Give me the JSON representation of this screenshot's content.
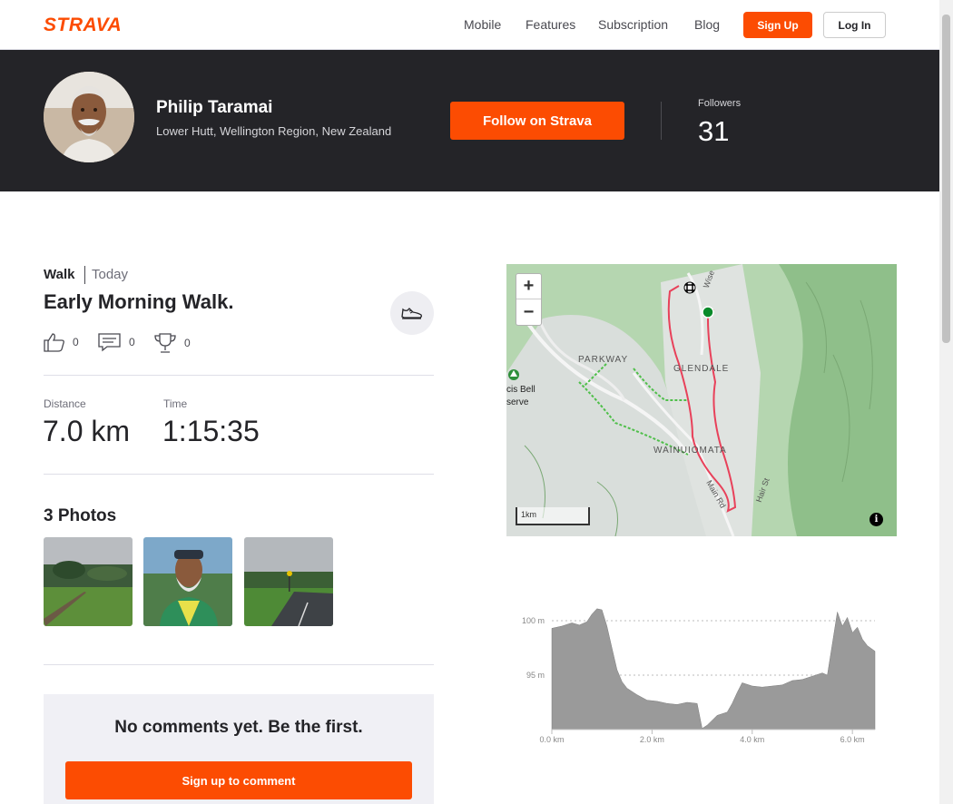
{
  "nav": {
    "logo": "STRAVA",
    "links": [
      "Mobile",
      "Features",
      "Subscription",
      "Blog"
    ],
    "signup": "Sign Up",
    "login": "Log In"
  },
  "athlete": {
    "name": "Philip Taramai",
    "location": "Lower Hutt, Wellington Region, New Zealand",
    "follow_label": "Follow on Strava",
    "followers_label": "Followers",
    "followers_count": "31"
  },
  "activity": {
    "sport": "Walk",
    "when": "Today",
    "title": "Early Morning Walk.",
    "kudos": "0",
    "comments": "0",
    "achievements": "0",
    "stats": [
      {
        "label": "Distance",
        "value": "7.0 km"
      },
      {
        "label": "Time",
        "value": "1:15:35"
      }
    ],
    "photos_title": "3 Photos"
  },
  "comments": {
    "empty_text": "No comments yet. Be the first.",
    "cta": "Sign up to comment"
  },
  "map": {
    "zoom_in": "+",
    "zoom_out": "−",
    "scale": "1km",
    "labels": [
      "PARKWAY",
      "GLENDALE",
      "WAINUIOMATA",
      "Main Rd",
      "Hair St",
      "Wise",
      "cis Bell",
      "serve"
    ],
    "info": "i"
  },
  "chart_data": {
    "type": "area",
    "title": "",
    "xlabel": "",
    "ylabel": "",
    "x_ticks": [
      "0.0 km",
      "2.0 km",
      "4.0 km",
      "6.0 km"
    ],
    "y_ticks": [
      "95 m",
      "100 m"
    ],
    "xlim": [
      0,
      6.5
    ],
    "ylim": [
      90,
      102
    ],
    "x": [
      0.0,
      0.2,
      0.4,
      0.55,
      0.7,
      0.8,
      0.9,
      1.0,
      1.1,
      1.2,
      1.3,
      1.4,
      1.5,
      1.7,
      1.9,
      2.1,
      2.3,
      2.5,
      2.7,
      2.9,
      3.0,
      3.1,
      3.3,
      3.5,
      3.6,
      3.7,
      3.8,
      4.0,
      4.2,
      4.4,
      4.6,
      4.8,
      5.0,
      5.2,
      5.4,
      5.5,
      5.6,
      5.7,
      5.8,
      5.9,
      6.0,
      6.1,
      6.2,
      6.3,
      6.45
    ],
    "values": [
      99.3,
      99.5,
      99.8,
      99.6,
      99.9,
      100.6,
      101.1,
      101.0,
      99.5,
      97.5,
      95.5,
      94.4,
      93.8,
      93.2,
      92.7,
      92.6,
      92.4,
      92.3,
      92.5,
      92.4,
      90.1,
      90.4,
      91.3,
      91.6,
      92.4,
      93.4,
      94.3,
      94.0,
      93.9,
      94.0,
      94.1,
      94.5,
      94.6,
      94.9,
      95.2,
      95.0,
      97.9,
      100.8,
      99.5,
      100.3,
      98.9,
      99.4,
      98.3,
      97.7,
      97.2
    ]
  }
}
